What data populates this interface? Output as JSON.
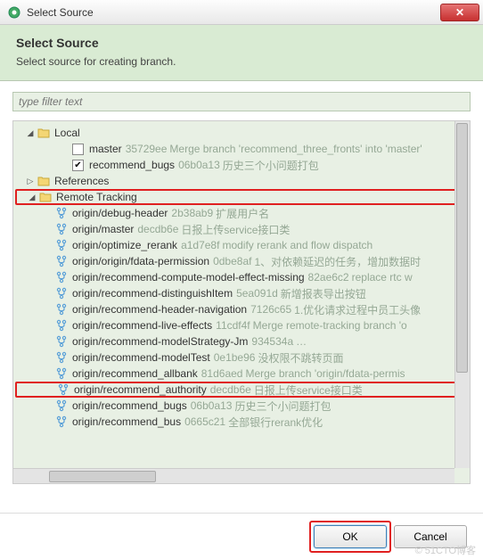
{
  "window": {
    "title": "Select Source",
    "close_glyph": "✕"
  },
  "header": {
    "title": "Select Source",
    "description": "Select source for creating branch."
  },
  "filter": {
    "placeholder": "type filter text"
  },
  "tree": {
    "local": {
      "label": "Local",
      "expanded": true,
      "items": [
        {
          "name": "master",
          "hash": "35729ee",
          "msg": "Merge branch 'recommend_three_fronts' into 'master'",
          "checked": false
        },
        {
          "name": "recommend_bugs",
          "hash": "06b0a13",
          "msg": "历史三个小问题打包",
          "checked": true
        }
      ]
    },
    "references": {
      "label": "References",
      "expanded": false
    },
    "remote": {
      "label": "Remote Tracking",
      "expanded": true,
      "items": [
        {
          "name": "origin/debug-header",
          "hash": "2b38ab9",
          "msg": "扩展用户名"
        },
        {
          "name": "origin/master",
          "hash": "decdb6e",
          "msg": "日报上传service接口类"
        },
        {
          "name": "origin/optimize_rerank",
          "hash": "a1d7e8f",
          "msg": "modify rerank and flow dispatch"
        },
        {
          "name": "origin/origin/fdata-permission",
          "hash": "0dbe8af",
          "msg": "1、对依赖延迟的任务，增加数据时"
        },
        {
          "name": "origin/recommend-compute-model-effect-missing",
          "hash": "82ae6c2",
          "msg": "replace rtc w"
        },
        {
          "name": "origin/recommend-distinguishItem",
          "hash": "5ea091d",
          "msg": "新增报表导出按钮"
        },
        {
          "name": "origin/recommend-header-navigation",
          "hash": "7126c65",
          "msg": "1.优化请求过程中员工头像"
        },
        {
          "name": "origin/recommend-live-effects",
          "hash": "11cdf4f",
          "msg": "Merge remote-tracking branch 'o"
        },
        {
          "name": "origin/recommend-modelStrategy-Jm",
          "hash": "934534a",
          "msg": "…"
        },
        {
          "name": "origin/recommend-modelTest",
          "hash": "0e1be96",
          "msg": "没权限不跳转页面"
        },
        {
          "name": "origin/recommend_allbank",
          "hash": "81d6aed",
          "msg": "Merge branch 'origin/fdata-permis"
        },
        {
          "name": "origin/recommend_authority",
          "hash": "decdb6e",
          "msg": "日报上传service接口类",
          "highlight": true
        },
        {
          "name": "origin/recommend_bugs",
          "hash": "06b0a13",
          "msg": "历史三个小问题打包"
        },
        {
          "name": "origin/recommend_bus",
          "hash": "0665c21",
          "msg": "全部银行rerank优化"
        }
      ]
    }
  },
  "buttons": {
    "ok": "OK",
    "cancel": "Cancel"
  },
  "watermark": "© 51CTO博客"
}
